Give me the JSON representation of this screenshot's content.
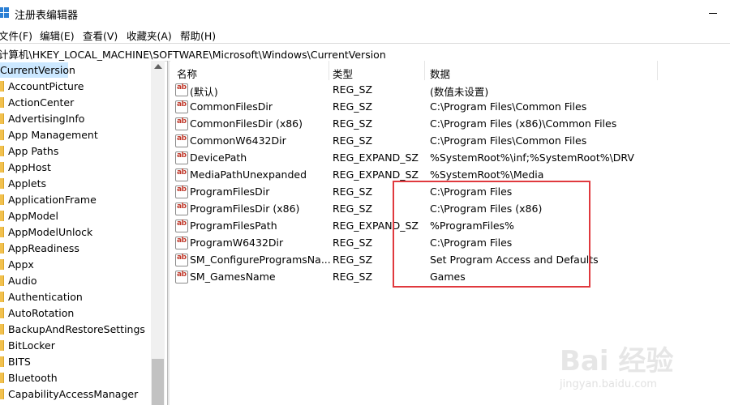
{
  "window": {
    "title": "注册表编辑器"
  },
  "menu": [
    "文件(F)",
    "编辑(E)",
    "查看(V)",
    "收藏夹(A)",
    "帮助(H)"
  ],
  "address": "计算机\\HKEY_LOCAL_MACHINE\\SOFTWARE\\Microsoft\\Windows\\CurrentVersion",
  "tree": {
    "selected": "CurrentVersion",
    "items": [
      "AccountPicture",
      "ActionCenter",
      "AdvertisingInfo",
      "App Management",
      "App Paths",
      "AppHost",
      "Applets",
      "ApplicationFrame",
      "AppModel",
      "AppModelUnlock",
      "AppReadiness",
      "Appx",
      "Audio",
      "Authentication",
      "AutoRotation",
      "BackupAndRestoreSettings",
      "BitLocker",
      "BITS",
      "Bluetooth",
      "CapabilityAccessManager"
    ]
  },
  "columns": {
    "name": "名称",
    "type": "类型",
    "data": "数据"
  },
  "rows": [
    {
      "name": "(默认)",
      "type": "REG_SZ",
      "data": "(数值未设置)"
    },
    {
      "name": "CommonFilesDir",
      "type": "REG_SZ",
      "data": "C:\\Program Files\\Common Files"
    },
    {
      "name": "CommonFilesDir (x86)",
      "type": "REG_SZ",
      "data": "C:\\Program Files (x86)\\Common Files"
    },
    {
      "name": "CommonW6432Dir",
      "type": "REG_SZ",
      "data": "C:\\Program Files\\Common Files"
    },
    {
      "name": "DevicePath",
      "type": "REG_EXPAND_SZ",
      "data": "%SystemRoot%\\inf;%SystemRoot%\\DRV"
    },
    {
      "name": "MediaPathUnexpanded",
      "type": "REG_EXPAND_SZ",
      "data": "%SystemRoot%\\Media"
    },
    {
      "name": "ProgramFilesDir",
      "type": "REG_SZ",
      "data": "C:\\Program Files"
    },
    {
      "name": "ProgramFilesDir (x86)",
      "type": "REG_SZ",
      "data": "C:\\Program Files (x86)"
    },
    {
      "name": "ProgramFilesPath",
      "type": "REG_EXPAND_SZ",
      "data": "%ProgramFiles%"
    },
    {
      "name": "ProgramW6432Dir",
      "type": "REG_SZ",
      "data": "C:\\Program Files"
    },
    {
      "name": "SM_ConfigureProgramsNa...",
      "type": "REG_SZ",
      "data": "Set Program Access and Defaults"
    },
    {
      "name": "SM_GamesName",
      "type": "REG_SZ",
      "data": "Games"
    }
  ],
  "icons": {
    "value": "ab",
    "folder": "folder-icon"
  },
  "watermark": {
    "logo": "Bai 经验",
    "sub": "jingyan.baidu.com"
  },
  "colors": {
    "selection": "#cce8ff",
    "highlight": "#e0393e",
    "folder": "#f2c14e"
  }
}
